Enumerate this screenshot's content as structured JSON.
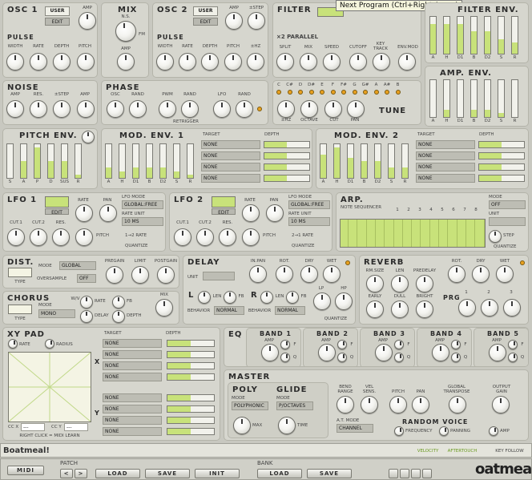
{
  "tooltip": "Next Program (Ctrl+Right Arrow)",
  "osc1": {
    "title": "OSC 1",
    "user": "USER",
    "edit": "EDIT",
    "amp": "AMP",
    "pulse": "PULSE",
    "labels": [
      "WIDTH",
      "RATE",
      "DEPTH",
      "PITCH"
    ]
  },
  "mix": {
    "title": "MIX",
    "ns": "N.S.",
    "fm": "FM",
    "amp": "AMP"
  },
  "osc2": {
    "title": "OSC 2",
    "user": "USER",
    "edit": "EDIT",
    "amp": "AMP",
    "step": "±STEP",
    "pulse": "PULSE",
    "labels": [
      "WIDTH",
      "RATE",
      "DEPTH",
      "PITCH",
      "±HZ"
    ]
  },
  "filter": {
    "title": "FILTER",
    "parallel": "×2 PARALLEL",
    "labels": [
      "SPLIT",
      "MIX",
      "SPEED",
      "CUTOFF",
      "KEY TRACK",
      "ENV.MOD"
    ]
  },
  "filter_env": {
    "title": "FILTER ENV.",
    "labels": [
      "A",
      "H",
      "D1",
      "B",
      "D2",
      "S",
      "R"
    ],
    "levels": [
      0.8,
      0.8,
      0.8,
      0.6,
      0.6,
      0.4,
      0.3
    ]
  },
  "amp_env": {
    "title": "AMP. ENV.",
    "labels": [
      "A",
      "H",
      "D1",
      "B",
      "D2",
      "S",
      "R"
    ],
    "levels": [
      0.0,
      0.2,
      0.0,
      0.2,
      0.2,
      0.1,
      0.0
    ]
  },
  "noise": {
    "title": "NOISE",
    "labels": [
      "AMP",
      "RES.",
      "±STEP",
      "AMP"
    ]
  },
  "phase": {
    "title": "PHASE",
    "labels": [
      "OSC",
      "RAND",
      "PWM",
      "RAND",
      "LFO",
      "RAND"
    ],
    "retrigger": "RETRIGGER"
  },
  "tune": {
    "title": "TUNE",
    "notes": [
      "C",
      "C#",
      "D",
      "D#",
      "E",
      "F",
      "F#",
      "G",
      "G#",
      "A",
      "A#",
      "B"
    ],
    "labels": [
      "±HZ",
      "OCTAVE",
      "CUT",
      "PAN"
    ]
  },
  "pitch_env": {
    "title": "PITCH ENV.",
    "labels": [
      "S",
      "A",
      "P",
      "D",
      "SUS",
      "R"
    ],
    "levels": [
      0.0,
      0.5,
      0.9,
      0.5,
      0.5,
      0.1
    ]
  },
  "mod_env1": {
    "title": "MOD. ENV. 1",
    "labels": [
      "A",
      "H",
      "D1",
      "B",
      "D2",
      "S",
      "R"
    ],
    "levels": [
      0.3,
      0.2,
      0.3,
      0.3,
      0.3,
      0.2,
      0.1
    ],
    "target_hdr": "TARGET",
    "depth_hdr": "DEPTH",
    "targets": [
      "NONE",
      "NONE",
      "NONE",
      "NONE"
    ],
    "depths": [
      0.5,
      0.5,
      0.5,
      0.5
    ]
  },
  "mod_env2": {
    "title": "MOD. ENV. 2",
    "labels": [
      "A",
      "H",
      "D1",
      "B",
      "D2",
      "S",
      "R"
    ],
    "levels": [
      0.7,
      0.9,
      0.6,
      0.5,
      0.5,
      0.3,
      0.3
    ],
    "target_hdr": "TARGET",
    "depth_hdr": "DEPTH",
    "targets": [
      "NONE",
      "NONE",
      "NONE",
      "NONE"
    ],
    "depths": [
      0.5,
      0.5,
      0.5,
      0.5
    ]
  },
  "lfo1": {
    "title": "LFO 1",
    "edit": "EDIT",
    "rate": "RATE",
    "pan": "PAN",
    "mode_lbl": "LFO MODE",
    "mode": "GLOBAL:FREE",
    "unit_lbl": "RATE UNIT",
    "unit": "10 MS",
    "quantize": "QUANTIZE",
    "link": "1→2 RATE",
    "labels": [
      "CUT.1",
      "CUT.2",
      "RES.",
      "PITCH"
    ]
  },
  "lfo2": {
    "title": "LFO 2",
    "edit": "EDIT",
    "rate": "RATE",
    "pan": "PAN",
    "mode_lbl": "LFO MODE",
    "mode": "GLOBAL:FREE",
    "unit_lbl": "RATE UNIT",
    "unit": "10 MS",
    "quantize": "QUANTIZE",
    "link": "2→1 RATE",
    "labels": [
      "CUT.1",
      "CUT.2",
      "RES.",
      "PITCH"
    ]
  },
  "arp": {
    "title": "ARP.",
    "seq": "NOTE SEQUENCER",
    "mode_lbl": "MODE",
    "mode": "OFF",
    "unit_lbl": "UNIT",
    "step": "STEP",
    "quantize": "QUANTIZE",
    "seq_nums": [
      "1",
      "2",
      "3",
      "4",
      "5",
      "6",
      "7",
      "8"
    ]
  },
  "dist": {
    "title": "DIST.",
    "type": "TYPE",
    "mode_lbl": "MODE",
    "mode": "GLOBAL",
    "os_lbl": "OVERSAMPLE",
    "os": "OFF",
    "labels": [
      "PREGAIN",
      "LIMIT",
      "POSTGAIN"
    ]
  },
  "delay": {
    "title": "DELAY",
    "unit_lbl": "UNIT",
    "labels": [
      "IN.PAN",
      "ROT.",
      "DRY",
      "WET"
    ],
    "l": "L",
    "r": "R",
    "len": "LEN",
    "fb": "FB",
    "mode_l": "NORMAL",
    "mode_r": "NORMAL",
    "mode_lbl": "BEHAVIOR",
    "lp": "LP",
    "hp": "HP",
    "quantize": "QUANTIZE"
  },
  "reverb": {
    "title": "REVERB",
    "labels": [
      "RM.SIZE",
      "LEN",
      "PREDELAY",
      "ROT.",
      "DRY",
      "WET",
      "EARLY",
      "DULL",
      "BRIGHT"
    ],
    "prg": "PRG",
    "prg_nums": [
      "1",
      "2",
      "3"
    ]
  },
  "chorus": {
    "title": "CHORUS",
    "mode_lbl": "MODE",
    "mode": "MONO",
    "type": "TYPE",
    "labels": [
      "RATE",
      "FB",
      "DELAY",
      "DEPTH",
      "MIX"
    ],
    "wv": "W/V"
  },
  "xy": {
    "title": "XY PAD",
    "rate": "RATE",
    "radius": "RADIUS",
    "target_hdr": "TARGET",
    "depth_hdr": "DEPTH",
    "x": "X",
    "y": "Y",
    "cc_x": "CC X",
    "cc_y": "CC Y",
    "cc_val": "---",
    "hint": "RIGHT CLICK = MIDI LEARN",
    "x_targets": [
      "NONE",
      "NONE",
      "NONE",
      "NONE"
    ],
    "y_targets": [
      "NONE",
      "NONE",
      "NONE",
      "NONE"
    ]
  },
  "eq": {
    "title": "EQ",
    "bands": [
      "BAND 1",
      "BAND 2",
      "BAND 3",
      "BAND 4",
      "BAND 5"
    ],
    "amp": "AMP",
    "f": "F",
    "q": "Q"
  },
  "master": {
    "title": "MASTER",
    "poly": "POLY",
    "glide": "GLIDE",
    "mode_lbl": "MODE",
    "poly_mode": "POLYPHONIC",
    "glide_mode": "P/OCTAVES",
    "max": "MAX",
    "time": "TIME",
    "labels": [
      "BEND RANGE",
      "VEL SENS.",
      "PITCH",
      "PAN",
      "GLOBAL TRANSPOSE",
      "OUTPUT GAIN"
    ],
    "at_lbl": "A.T. MODE",
    "at": "CHANNEL",
    "random": "RANDOM VOICE",
    "freq": "FREQUENCY",
    "panning": "PANNING",
    "amp": "AMP"
  },
  "status": {
    "patch_name": "Boatmeal!",
    "velocity": "VELOCITY",
    "aftertouch": "AFTERTOUCH",
    "keyfollow": "KEY FOLLOW"
  },
  "toolbar": {
    "midi": "MIDI",
    "patch": "PATCH",
    "bank": "BANK",
    "load": "LOAD",
    "save": "SAVE",
    "init": "INIT",
    "logo": "oatmeal",
    "prev": "<",
    "next": ">"
  }
}
